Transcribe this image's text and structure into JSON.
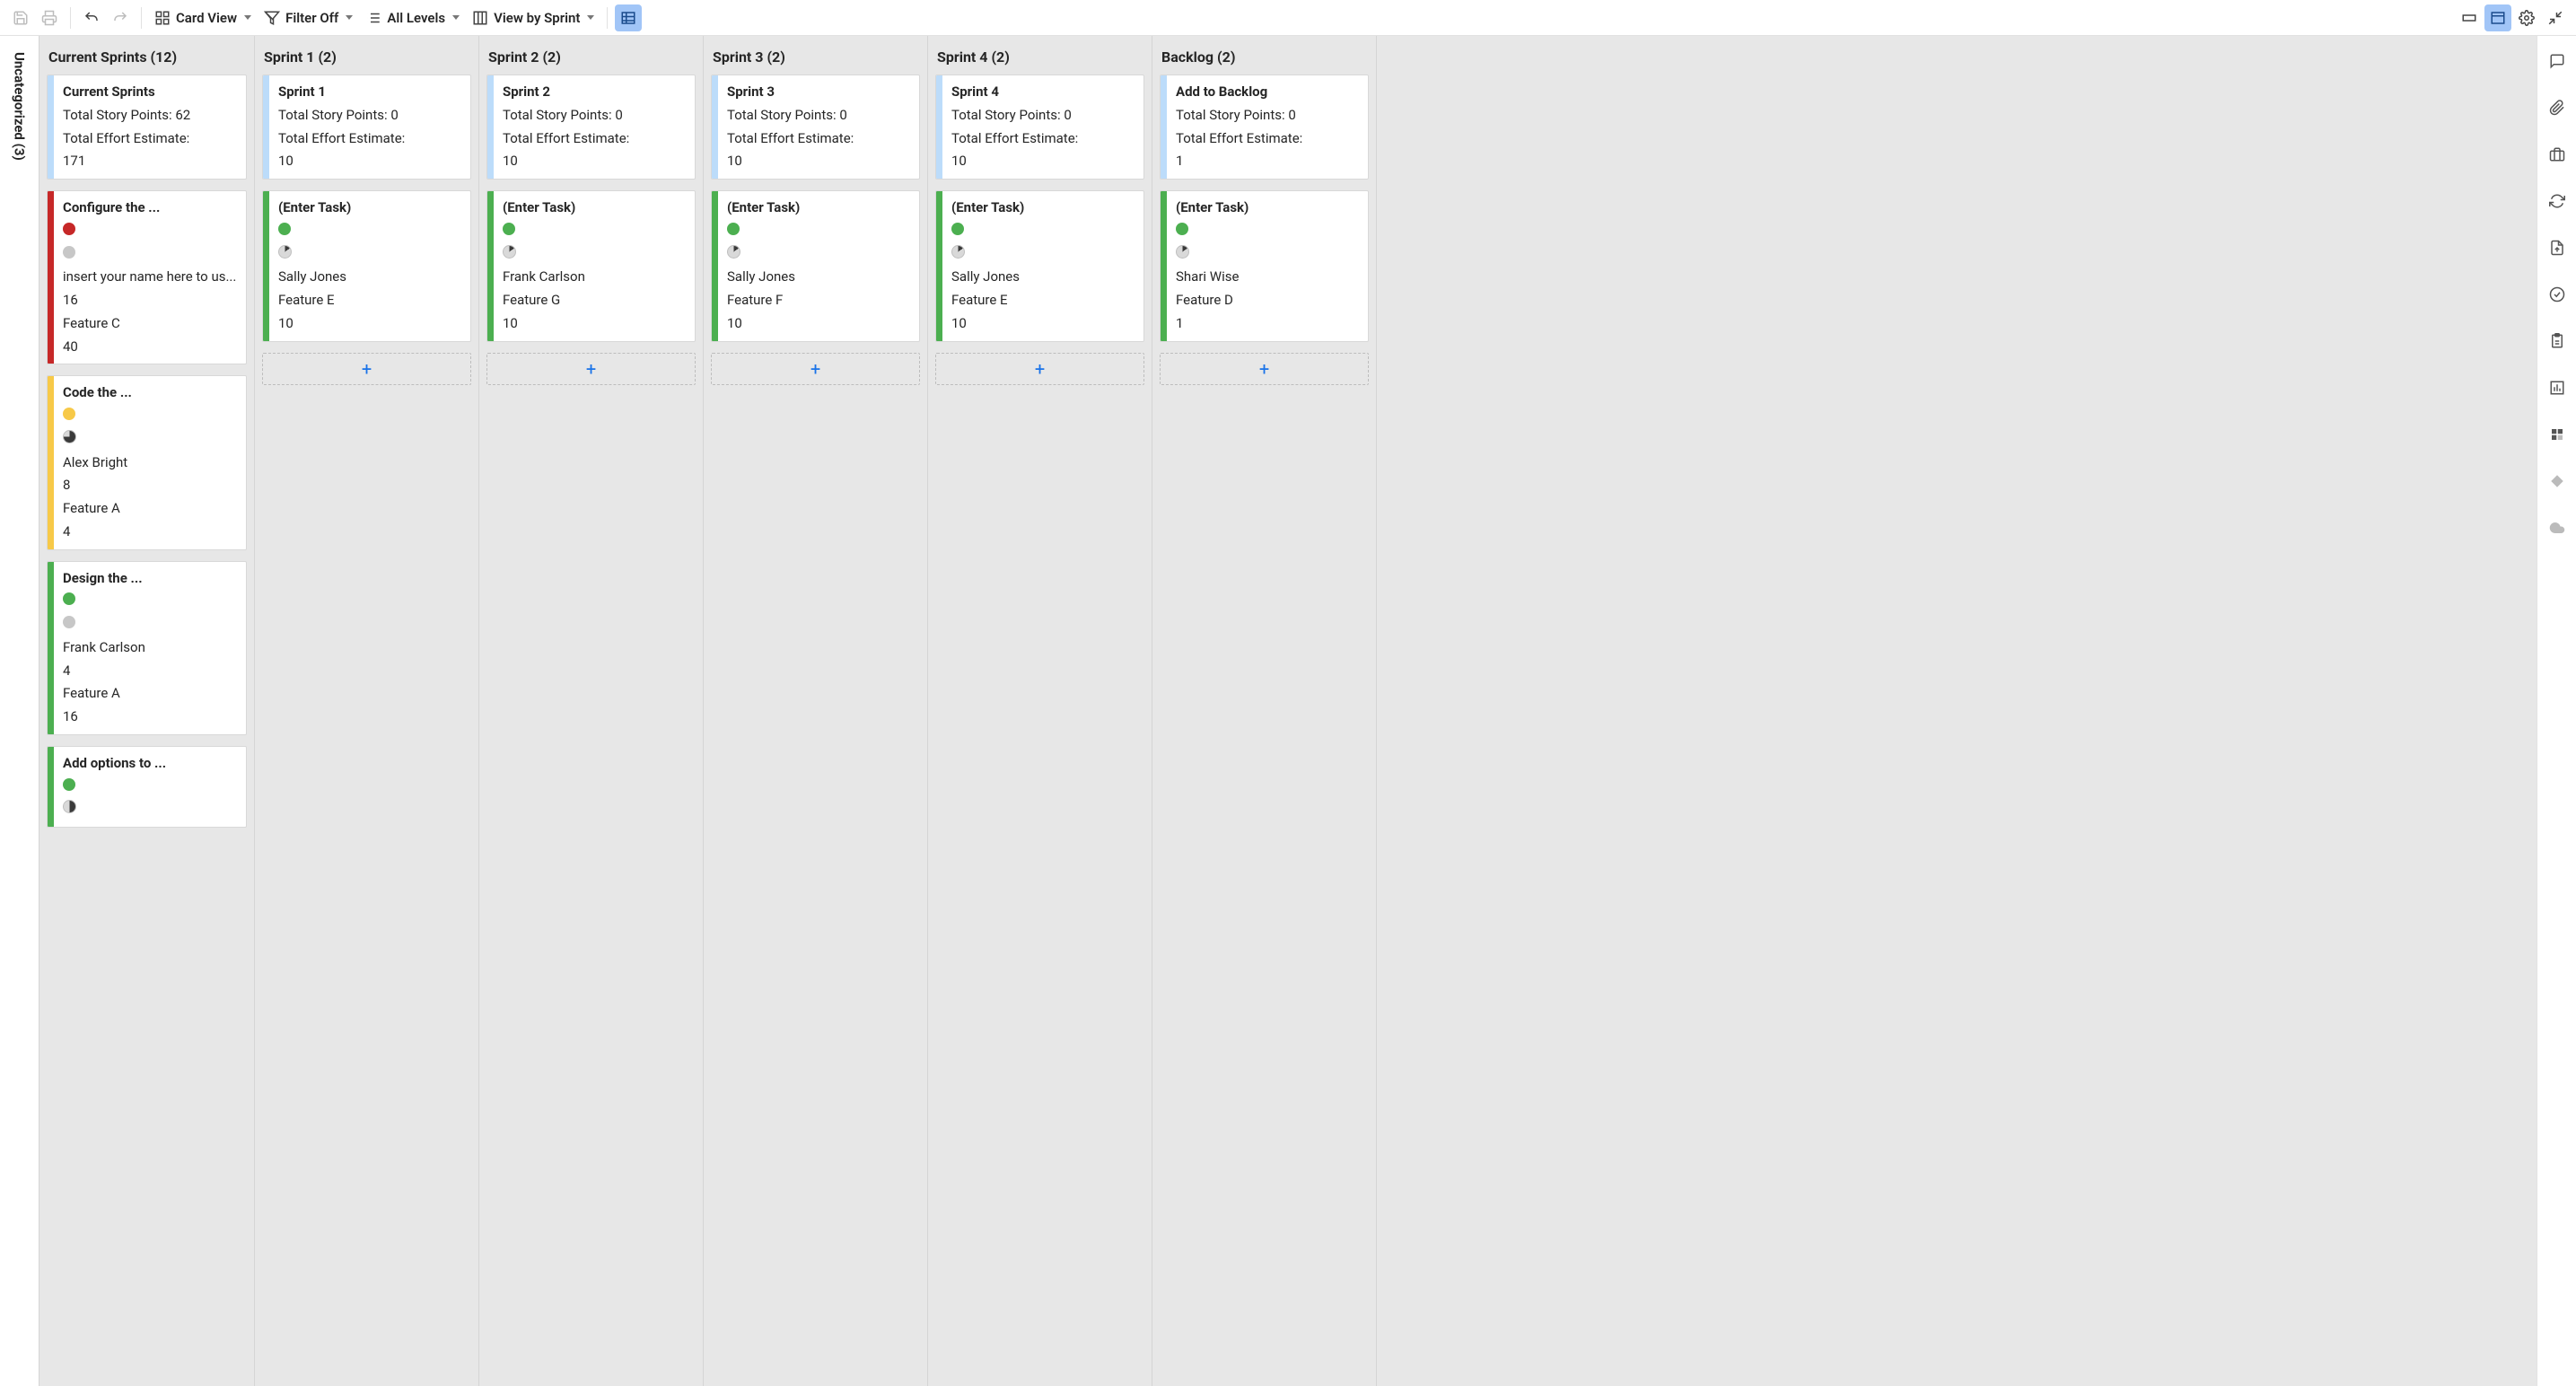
{
  "toolbar": {
    "card_view": "Card View",
    "filter_off": "Filter Off",
    "all_levels": "All Levels",
    "view_by_sprint": "View by Sprint"
  },
  "uncategorized": {
    "label": "Uncategorized (3)"
  },
  "columns": [
    {
      "header": "Current Sprints (12)",
      "summary": {
        "stripe": "blue",
        "title": "Current Sprints",
        "points": "Total Story Points: 62",
        "effort_label": "Total Effort Estimate:",
        "effort_value": "171"
      },
      "cards": [
        {
          "stripe": "red",
          "title": "Configure the ...",
          "dot1": "red",
          "dot2_type": "dot",
          "dot2": "grey",
          "assignee": "insert your name here to us...",
          "points": "16",
          "feature": "Feature C",
          "effort": "40"
        },
        {
          "stripe": "yellow",
          "title": "Code the ...",
          "dot1": "yellow",
          "dot2_type": "pie",
          "pie_pct": 75,
          "assignee": "Alex Bright",
          "points": "8",
          "feature": "Feature A",
          "effort": "4"
        },
        {
          "stripe": "green",
          "title": "Design the ...",
          "dot1": "green",
          "dot2_type": "dot",
          "dot2": "grey",
          "assignee": "Frank Carlson",
          "points": "4",
          "feature": "Feature A",
          "effort": "16"
        },
        {
          "stripe": "green",
          "title": "Add options to ...",
          "dot1": "green",
          "dot2_type": "pie",
          "pie_pct": 50
        }
      ],
      "show_add": false
    },
    {
      "header": "Sprint 1 (2)",
      "summary": {
        "stripe": "blue",
        "title": "Sprint 1",
        "points": "Total Story Points: 0",
        "effort_label": "Total Effort Estimate:",
        "effort_value": "10"
      },
      "cards": [
        {
          "stripe": "green",
          "title": "(Enter Task)",
          "dot1": "green",
          "dot2_type": "pie",
          "pie_pct": 15,
          "assignee": "Sally Jones",
          "feature": "Feature E",
          "effort": "10"
        }
      ],
      "show_add": true
    },
    {
      "header": "Sprint 2 (2)",
      "summary": {
        "stripe": "blue",
        "title": "Sprint 2",
        "points": "Total Story Points: 0",
        "effort_label": "Total Effort Estimate:",
        "effort_value": "10"
      },
      "cards": [
        {
          "stripe": "green",
          "title": "(Enter Task)",
          "dot1": "green",
          "dot2_type": "pie",
          "pie_pct": 15,
          "assignee": "Frank Carlson",
          "feature": "Feature G",
          "effort": "10"
        }
      ],
      "show_add": true
    },
    {
      "header": "Sprint 3 (2)",
      "summary": {
        "stripe": "blue",
        "title": "Sprint 3",
        "points": "Total Story Points: 0",
        "effort_label": "Total Effort Estimate:",
        "effort_value": "10"
      },
      "cards": [
        {
          "stripe": "green",
          "title": "(Enter Task)",
          "dot1": "green",
          "dot2_type": "pie",
          "pie_pct": 15,
          "assignee": "Sally Jones",
          "feature": "Feature F",
          "effort": "10"
        }
      ],
      "show_add": true
    },
    {
      "header": "Sprint 4 (2)",
      "summary": {
        "stripe": "blue",
        "title": "Sprint 4",
        "points": "Total Story Points: 0",
        "effort_label": "Total Effort Estimate:",
        "effort_value": "10"
      },
      "cards": [
        {
          "stripe": "green",
          "title": "(Enter Task)",
          "dot1": "green",
          "dot2_type": "pie",
          "pie_pct": 15,
          "assignee": "Sally Jones",
          "feature": "Feature E",
          "effort": "10"
        }
      ],
      "show_add": true
    },
    {
      "header": "Backlog (2)",
      "summary": {
        "stripe": "blue",
        "title": "Add to Backlog",
        "points": "Total Story Points: 0",
        "effort_label": "Total Effort Estimate:",
        "effort_value": "1"
      },
      "cards": [
        {
          "stripe": "green",
          "title": "(Enter Task)",
          "dot1": "green",
          "dot2_type": "pie",
          "pie_pct": 15,
          "assignee": "Shari Wise",
          "feature": "Feature D",
          "effort": "1"
        }
      ],
      "show_add": true
    }
  ]
}
